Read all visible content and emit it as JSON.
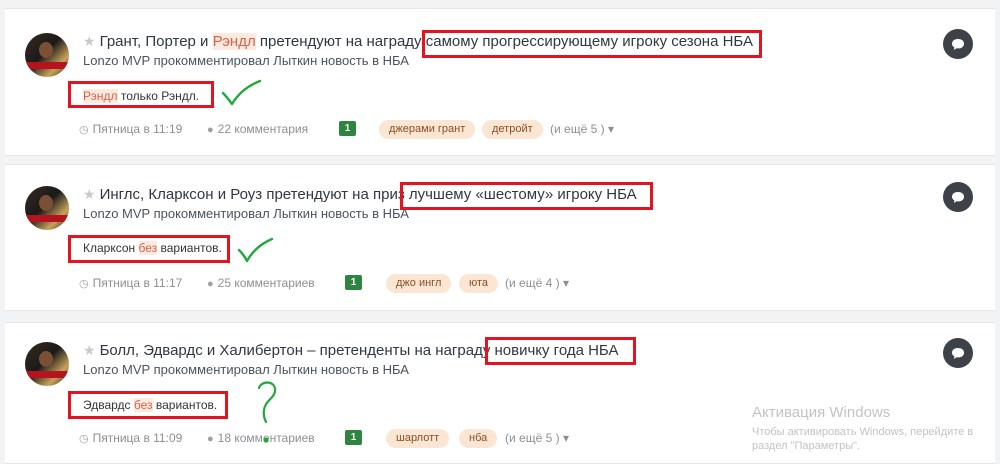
{
  "items": [
    {
      "title_pre": "Грант, Портер и ",
      "title_hl": "Рэндл",
      "title_post": " претендуют на награду самому прогрессирующему игроку сезона НБА",
      "subtitle": "Lonzo MVP прокомментировал Лыткин новость в НБА",
      "snippet_hl": "Рэндл",
      "snippet_post": " только Рэндл.",
      "date": "Пятница в 11:19",
      "comments": "22 комментария",
      "badge": "1",
      "tags": [
        "джерами грант",
        "детройт"
      ],
      "more": "(и ещё 5 )"
    },
    {
      "title_pre": "Инглс, Кларксон и Роуз претендуют на приз лучшему «шестому» игроку НБА",
      "title_hl": "",
      "title_post": "",
      "subtitle": "Lonzo MVP прокомментировал Лыткин новость в НБА",
      "snippet_pre": "Кларксон ",
      "snippet_hl": "без",
      "snippet_post": " вариантов.",
      "date": "Пятница в 11:17",
      "comments": "25 комментариев",
      "badge": "1",
      "tags": [
        "джо ингл",
        "юта"
      ],
      "more": "(и ещё 4 )"
    },
    {
      "title_pre": "Болл, Эдвардс и Халибертон – претенденты на награду новичку года НБА",
      "title_hl": "",
      "title_post": "",
      "subtitle": "Lonzo MVP прокомментировал Лыткин новость в НБА",
      "snippet_pre": "Эдвардс ",
      "snippet_hl": "без",
      "snippet_post": " вариантов.",
      "date": "Пятница в 11:09",
      "comments": "18 комментариев",
      "badge": "1",
      "tags": [
        "шарлотт",
        "нба"
      ],
      "more": "(и ещё 5 )"
    }
  ],
  "watermark": {
    "title": "Активация Windows",
    "line1": "Чтобы активировать Windows, перейдите в",
    "line2": "раздел \"Параметры\"."
  },
  "colors": {
    "highlight_text": "#d9634a",
    "annotation_red": "#e3141f",
    "annotation_green": "#22a83a",
    "badge_green": "#2e8540",
    "tag_bg": "#fbe6d4"
  },
  "icons": [
    "star-icon",
    "clock-icon",
    "comment-icon",
    "chevron-down-icon",
    "chat-bubble-icon"
  ]
}
